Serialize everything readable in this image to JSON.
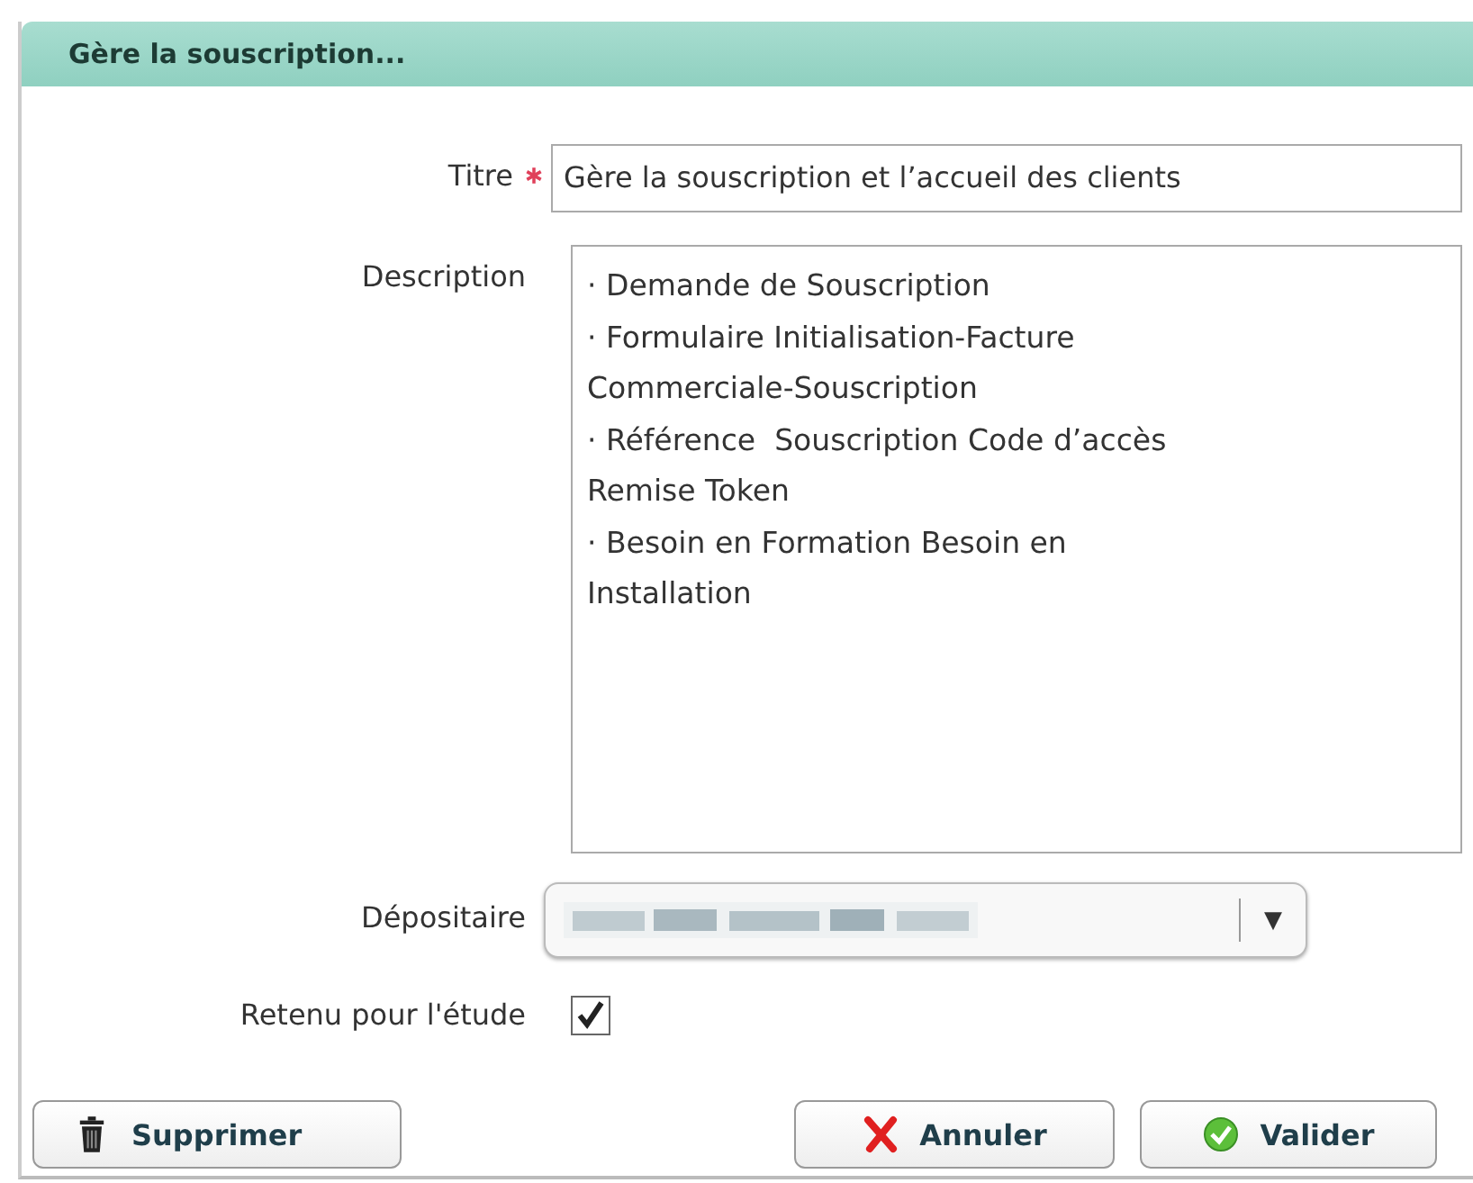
{
  "dialog": {
    "title": "Gère la souscription..."
  },
  "fields": [
    {
      "kind": "text",
      "label": "Titre",
      "required": true,
      "value": "Gère la souscription et l’accueil des clients"
    },
    {
      "kind": "textarea",
      "label": "Description",
      "lines": [
        "· Demande de Souscription",
        "· Formulaire Initialisation-Facture",
        "Commerciale-Souscription",
        "· Référence  Souscription Code d’accès",
        "Remise Token",
        "· Besoin en Formation Besoin en",
        "Installation"
      ]
    },
    {
      "kind": "select",
      "label": "Dépositaire",
      "arrow": "▼"
    },
    {
      "kind": "checkbox",
      "label": "Retenu pour l'étude",
      "checked": true
    }
  ],
  "buttons": [
    {
      "kind": "delete",
      "label": "Supprimer"
    },
    {
      "kind": "cancel",
      "label": "Annuler"
    },
    {
      "kind": "confirm",
      "label": "Valider"
    }
  ]
}
